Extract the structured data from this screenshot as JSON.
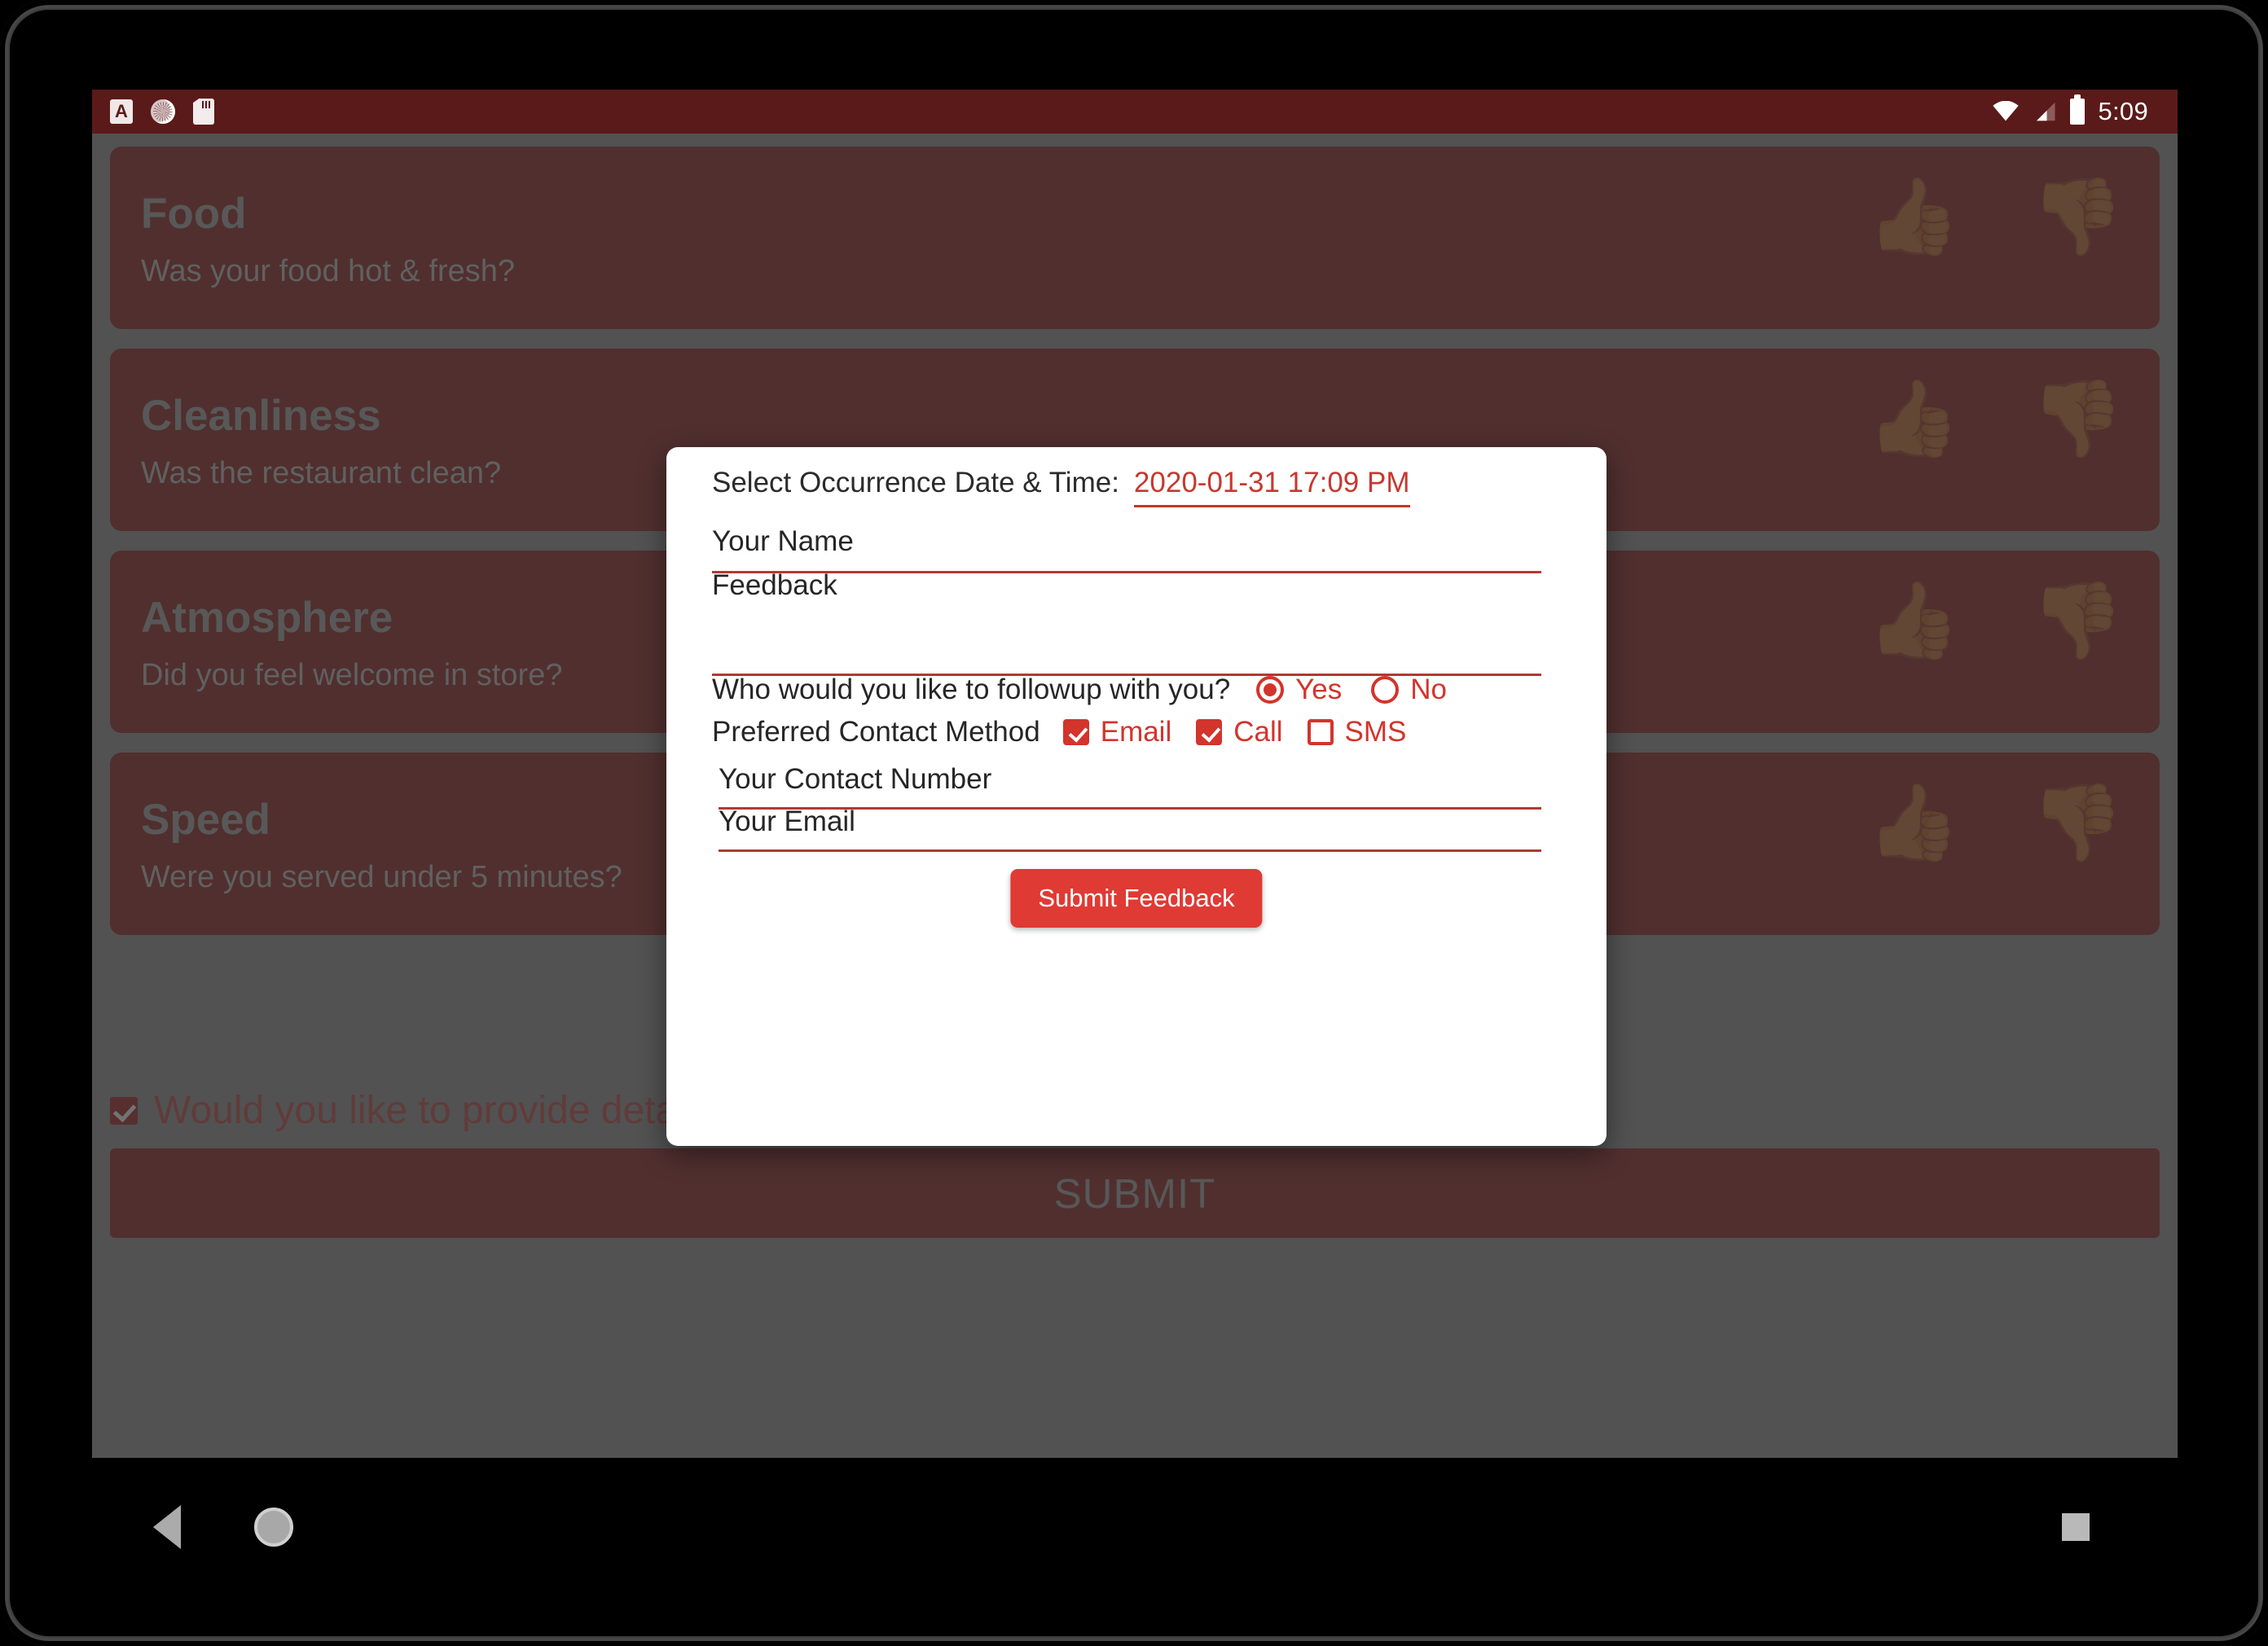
{
  "status_bar": {
    "icons": [
      "notification-a-icon",
      "sync-icon",
      "sd-card-icon",
      "wifi-icon",
      "cellular-signal-icon",
      "battery-icon"
    ],
    "clock": "5:09"
  },
  "survey": {
    "cards": [
      {
        "title": "Food",
        "subtitle": "Was your food hot & fresh?",
        "thumb_up": "👍",
        "thumb_down": "👎"
      },
      {
        "title": "Cleanliness",
        "subtitle": "Was the restaurant clean?",
        "thumb_up": "👍",
        "thumb_down": "👎"
      },
      {
        "title": "Atmosphere",
        "subtitle": "Did you feel welcome in store?",
        "thumb_up": "👍",
        "thumb_down": "👎"
      },
      {
        "title": "Speed",
        "subtitle": "Were you served under 5 minutes?",
        "thumb_up": "👍",
        "thumb_down": "👎"
      }
    ],
    "detail_checkbox": {
      "label": "Would you like to provide details?",
      "checked": true
    },
    "submit_label": "SUBMIT"
  },
  "dialog": {
    "date_label": "Select Occurrence Date & Time:",
    "date_value": "2020-01-31 17:09 PM",
    "name_placeholder": "Your Name",
    "feedback_placeholder": "Feedback",
    "followup_question": "Who would you like to followup with you?",
    "followup_options": [
      {
        "label": "Yes",
        "selected": true
      },
      {
        "label": "No",
        "selected": false
      }
    ],
    "contact_method_label": "Preferred Contact Method",
    "contact_methods": [
      {
        "label": "Email",
        "checked": true
      },
      {
        "label": "Call",
        "checked": true
      },
      {
        "label": "SMS",
        "checked": false
      }
    ],
    "phone_placeholder": "Your Contact Number",
    "email_placeholder": "Your Email",
    "submit_label": "Submit Feedback"
  },
  "nav_bar": {
    "back": "back-icon",
    "home": "home-icon",
    "recents": "recents-icon"
  },
  "colors": {
    "card_red": "#6b1f1f",
    "accent_red": "#d3342c",
    "button_red": "#e03a34",
    "status_bar": "#5b1a1a"
  }
}
